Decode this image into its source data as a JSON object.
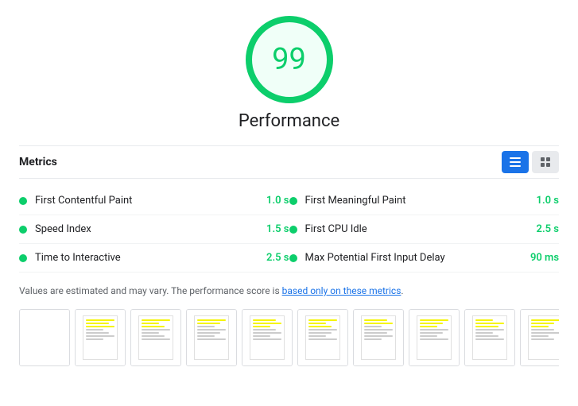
{
  "score": {
    "value": "99",
    "label": "Performance"
  },
  "metrics_header": {
    "title": "Metrics"
  },
  "metrics": [
    {
      "name": "First Contentful Paint",
      "value": "1.0 s",
      "dot_color": "#0cce6b"
    },
    {
      "name": "First Meaningful Paint",
      "value": "1.0 s",
      "dot_color": "#0cce6b"
    },
    {
      "name": "Speed Index",
      "value": "1.5 s",
      "dot_color": "#0cce6b"
    },
    {
      "name": "First CPU Idle",
      "value": "2.5 s",
      "dot_color": "#0cce6b"
    },
    {
      "name": "Time to Interactive",
      "value": "2.5 s",
      "dot_color": "#0cce6b"
    },
    {
      "name": "Max Potential First Input Delay",
      "value": "90 ms",
      "dot_color": "#0cce6b"
    }
  ],
  "disclaimer": {
    "text_before": "Values are estimated and may vary. The performance score is ",
    "link_text": "based only on these metrics",
    "text_after": "."
  },
  "filmstrip": {
    "frame_count": 10
  }
}
